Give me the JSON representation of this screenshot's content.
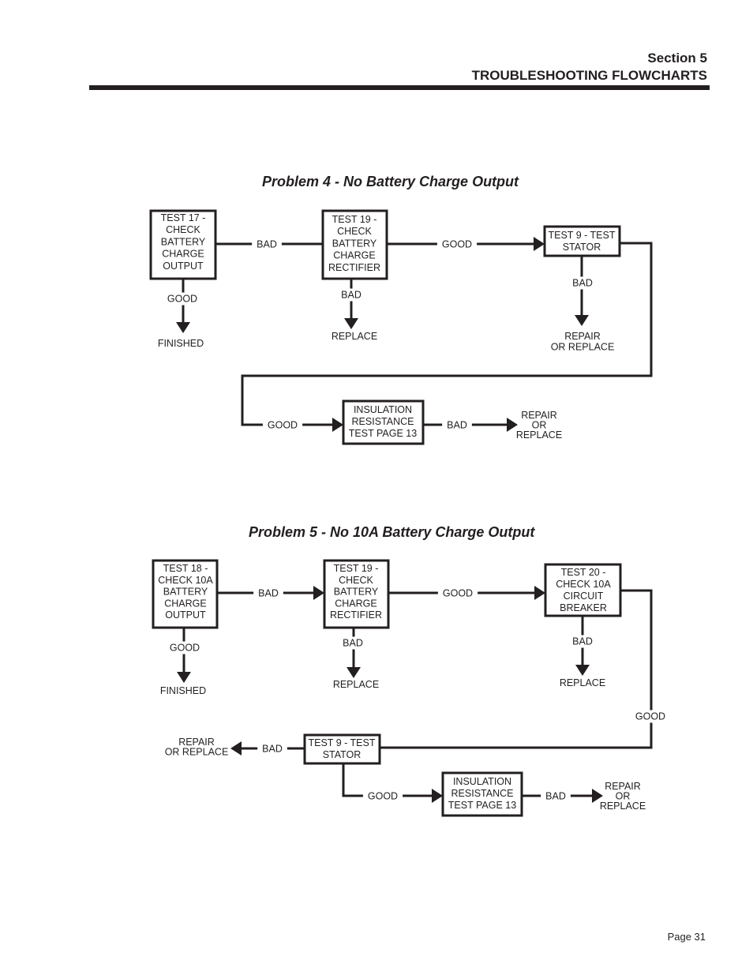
{
  "header": {
    "section": "Section 5",
    "title": "TROUBLESHOOTING FLOWCHARTS"
  },
  "problem4": {
    "title": "Problem 4 -  No Battery Charge Output",
    "nodes": {
      "test17": [
        "TEST 17 -",
        "CHECK",
        "BATTERY",
        "CHARGE",
        "OUTPUT"
      ],
      "test19": [
        "TEST 19 -",
        "CHECK",
        "BATTERY",
        "CHARGE",
        "RECTIFIER"
      ],
      "test9": [
        "TEST 9 - TEST",
        "STATOR"
      ],
      "insulation": [
        "INSULATION",
        "RESISTANCE",
        "TEST PAGE 13"
      ],
      "finished": [
        "FINISHED"
      ],
      "replace": [
        "REPLACE"
      ],
      "repair_or_replace_1": [
        "REPAIR",
        "OR REPLACE"
      ],
      "repair_or_replace_2": [
        "REPAIR",
        "OR",
        "REPLACE"
      ]
    },
    "edges": {
      "test17_bad": "BAD",
      "test17_good": "GOOD",
      "test19_good": "GOOD",
      "test19_bad": "BAD",
      "test9_bad": "BAD",
      "test9_good": "GOOD",
      "insulation_bad": "BAD"
    }
  },
  "problem5": {
    "title": "Problem 5 -  No 10A Battery Charge Output",
    "nodes": {
      "test18": [
        "TEST 18 -",
        "CHECK 10A",
        "BATTERY",
        "CHARGE",
        "OUTPUT"
      ],
      "test19": [
        "TEST 19 -",
        "CHECK",
        "BATTERY",
        "CHARGE",
        "RECTIFIER"
      ],
      "test20": [
        "TEST 20 -",
        "CHECK 10A",
        "CIRCUIT",
        "BREAKER"
      ],
      "test9": [
        "TEST 9 - TEST",
        "STATOR"
      ],
      "insulation": [
        "INSULATION",
        "RESISTANCE",
        "TEST PAGE 13"
      ],
      "finished": [
        "FINISHED"
      ],
      "replace_1": [
        "REPLACE"
      ],
      "replace_2": [
        "REPLACE"
      ],
      "repair_or_replace_1": [
        "REPAIR",
        "OR REPLACE"
      ],
      "repair_or_replace_2": [
        "REPAIR",
        "OR",
        "REPLACE"
      ]
    },
    "edges": {
      "test18_bad": "BAD",
      "test18_good": "GOOD",
      "test19_good": "GOOD",
      "test19_bad": "BAD",
      "test20_bad": "BAD",
      "test20_good": "GOOD",
      "test9_bad": "BAD",
      "test9_good": "GOOD",
      "insulation_bad": "BAD"
    }
  },
  "footer": {
    "page": "Page 31"
  }
}
